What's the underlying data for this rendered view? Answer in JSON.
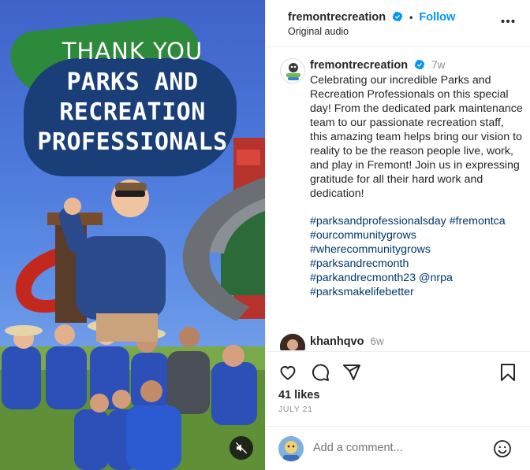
{
  "media": {
    "overlay_line1": "THANK YOU",
    "overlay_line2": "PARKS AND",
    "overlay_line3": "RECREATION",
    "overlay_line4": "PROFESSIONALS",
    "mute_icon": "muted-speaker-icon"
  },
  "header": {
    "username": "fremontrecreation",
    "follow_label": "Follow",
    "audio": "Original audio",
    "more_icon": "more-options-icon"
  },
  "caption": {
    "username": "fremontrecreation",
    "time": "7w",
    "text": "Celebrating our incredible Parks and Recreation Professionals on this special day! From the dedicated park maintenance team to our passionate recreation staff, this amazing team helps bring our vision to reality to be the reason people live, work, and play in Fremont! Join us in expressing gratitude for all their hard work and dedication!",
    "tags": [
      "#parksandprofessionalsday",
      "#fremontca",
      "#ourcommunitygrows",
      "#wherecommunitygrows",
      "#parksandrecmonth",
      "#parkandrecmonth23",
      "@nrpa",
      "#parksmakelifebetter"
    ]
  },
  "comment": {
    "username": "khanhqvo",
    "time": "6w"
  },
  "actions": {
    "icons": [
      "heart-icon",
      "comment-icon",
      "share-icon",
      "bookmark-icon"
    ],
    "likes": "41 likes",
    "date": "JULY 21"
  },
  "comment_box": {
    "placeholder": "Add a comment...",
    "emoji_icon": "emoji-icon"
  },
  "colors": {
    "link_blue": "#0095f6",
    "hashtag": "#00376b",
    "verified": "#0095f6"
  }
}
